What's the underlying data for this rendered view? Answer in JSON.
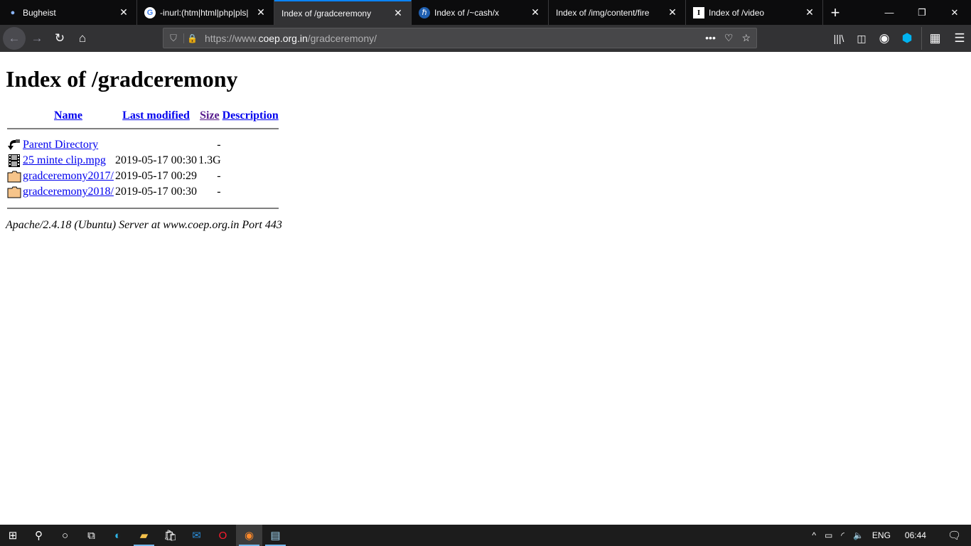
{
  "tabs": [
    {
      "label": "Bugheist",
      "icon": "dot-icon",
      "active": false
    },
    {
      "label": "-inurl:(htm|html|php|pls|",
      "icon": "google-icon",
      "active": false
    },
    {
      "label": "Index of /gradceremony",
      "icon": "none",
      "active": true
    },
    {
      "label": "Index of /~cash/x",
      "icon": "site-logo-icon",
      "active": false
    },
    {
      "label": "Index of /img/content/fire",
      "icon": "none",
      "active": false
    },
    {
      "label": "Index of /video",
      "icon": "i-icon",
      "active": false
    }
  ],
  "url": {
    "scheme": "https://www.",
    "host": "coep.org.in",
    "path": "/gradceremony/"
  },
  "page": {
    "title": "Index of /gradceremony",
    "headers": {
      "name": "Name",
      "modified": "Last modified",
      "size": "Size",
      "description": "Description"
    },
    "rows": [
      {
        "icon": "back-icon",
        "name": "Parent Directory",
        "modified": "",
        "size": "-"
      },
      {
        "icon": "movie-icon",
        "name": "25 minte clip.mpg",
        "modified": "2019-05-17 00:30",
        "size": "1.3G"
      },
      {
        "icon": "folder-icon",
        "name": "gradceremony2017/",
        "modified": "2019-05-17 00:29",
        "size": "-"
      },
      {
        "icon": "folder-icon",
        "name": "gradceremony2018/",
        "modified": "2019-05-17 00:30",
        "size": "-"
      }
    ],
    "address": "Apache/2.4.18 (Ubuntu) Server at www.coep.org.in Port 443"
  },
  "taskbar": {
    "lang": "ENG",
    "time": "06:44"
  },
  "colors": {
    "accent": "#0a84ff",
    "link": "#0000ee",
    "visited": "#551a8b"
  }
}
